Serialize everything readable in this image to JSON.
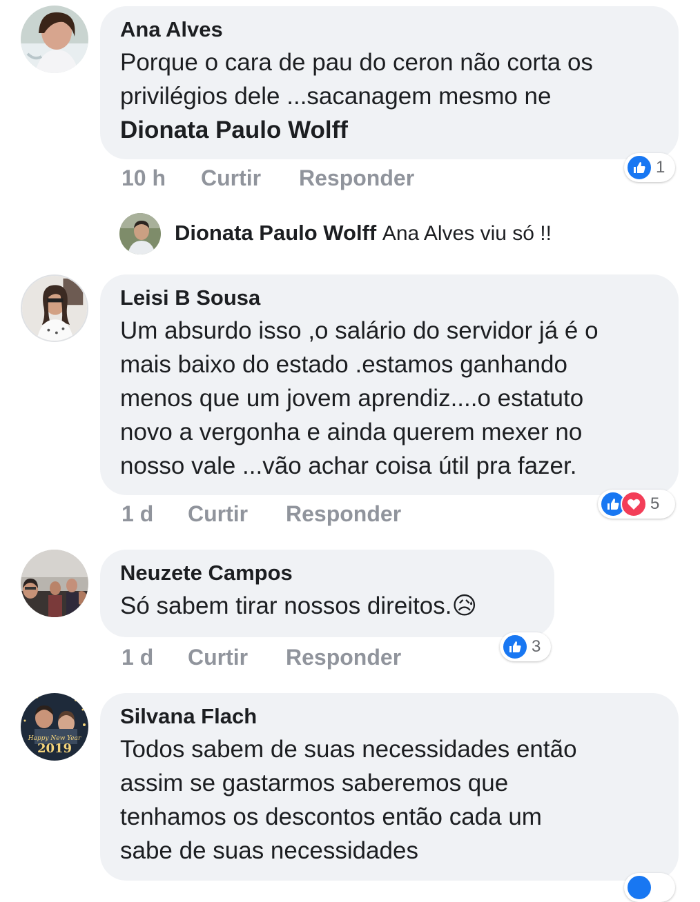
{
  "comments": [
    {
      "author": "Ana Alves",
      "lines": [
        "Porque o cara de pau do ceron não corta os",
        "privilégios dele ...sacanagem mesmo ne"
      ],
      "mention": "Dionata Paulo Wolff",
      "time": "10 h",
      "like_label": "Curtir",
      "reply_label": "Responder",
      "reaction_count": "1",
      "reactions": [
        "like"
      ]
    },
    {
      "author": "Leisi B Sousa",
      "lines": [
        "Um absurdo isso ,o salário do servidor já é o",
        "mais baixo do estado .estamos ganhando",
        "menos que um jovem aprendiz....o estatuto",
        "novo a vergonha e ainda querem mexer no",
        "nosso vale ...vão achar coisa útil pra fazer."
      ],
      "time": "1 d",
      "like_label": "Curtir",
      "reply_label": "Responder",
      "reaction_count": "5",
      "reactions": [
        "like",
        "love"
      ]
    },
    {
      "author": "Neuzete Campos",
      "lines": [
        "Só sabem tirar nossos direitos.😥"
      ],
      "time": "1 d",
      "like_label": "Curtir",
      "reply_label": "Responder",
      "reaction_count": "3",
      "reactions": [
        "like"
      ]
    },
    {
      "author": "Silvana Flach",
      "lines": [
        "Todos sabem de suas necessidades então",
        "assim se gastarmos saberemos que",
        "tenhamos os descontos então cada um",
        "sabe de suas necessidades"
      ],
      "avatar_text": "Happy New Year 2019"
    }
  ],
  "reply": {
    "author": "Dionata Paulo Wolff",
    "text": "Ana Alves  viu só !!"
  },
  "colors": {
    "bubble": "#f0f2f5",
    "meta": "#90949c",
    "like": "#1877f2",
    "love": "#f33e58"
  }
}
